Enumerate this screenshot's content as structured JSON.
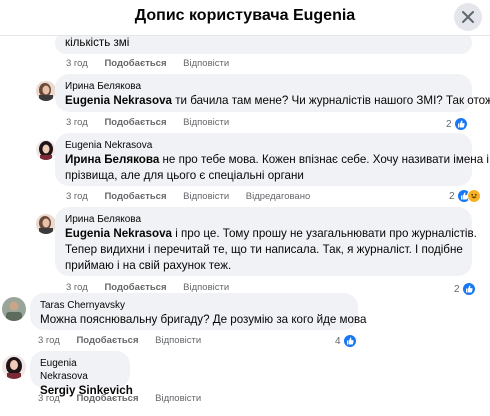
{
  "header": {
    "title": "Допис користувача Eugenia"
  },
  "colors": {
    "like": "#1877f2",
    "meta": "#65676b",
    "bubble": "#f0f2f5"
  },
  "icons": {
    "close": "close-icon",
    "like": "like-icon",
    "haha": "haha-icon"
  },
  "comments": [
    {
      "text": "кількість змі",
      "meta": {
        "time": "3 год",
        "like": "Подобається",
        "reply": "Відповісти"
      }
    },
    {
      "author": "Ирина Белякова",
      "mention": "Eugenia Nekrasova",
      "text": " ти бачила там мене? Чи журналістів нашого ЗМІ? Так отож",
      "meta": {
        "time": "3 год",
        "like": "Подобається",
        "reply": "Відповісти"
      },
      "reactions": "2"
    },
    {
      "author": "Eugenia Nekrasova",
      "mention": "Ирина Белякова",
      "text": " не про тебе мова. Кожен впізнає себе. Хочу називати імена і",
      "text2": "прізвища, але для цього є спеціальні органи",
      "meta": {
        "time": "3 год",
        "like": "Подобається",
        "reply": "Відповісти",
        "edited": "Відредаговано"
      },
      "reactions": "2"
    },
    {
      "author": "Ирина Белякова",
      "mention": "Eugenia Nekrasova",
      "text": " і про це. Тому прошу не узагальнювати про журналістів.",
      "text2": "Тепер видихни і перечитай те, що ти написала. Так, я журналіст. І подібне",
      "text3": "приймаю і на свій рахунок теж.",
      "meta": {
        "time": "3 год",
        "like": "Подобається",
        "reply": "Відповісти"
      },
      "reactions": "2"
    },
    {
      "author": "Taras Chernyavsky",
      "text": "Можна пояснювальну бригаду? Де розумію за кого йде мова",
      "meta": {
        "time": "3 год",
        "like": "Подобається",
        "reply": "Відповісти"
      },
      "reactions": "4"
    },
    {
      "author": "Eugenia Nekrasova",
      "mention": "Sergiy Sinkevich",
      "meta": {
        "time": "3 год",
        "like": "Подобається",
        "reply": "Відповісти"
      }
    }
  ]
}
